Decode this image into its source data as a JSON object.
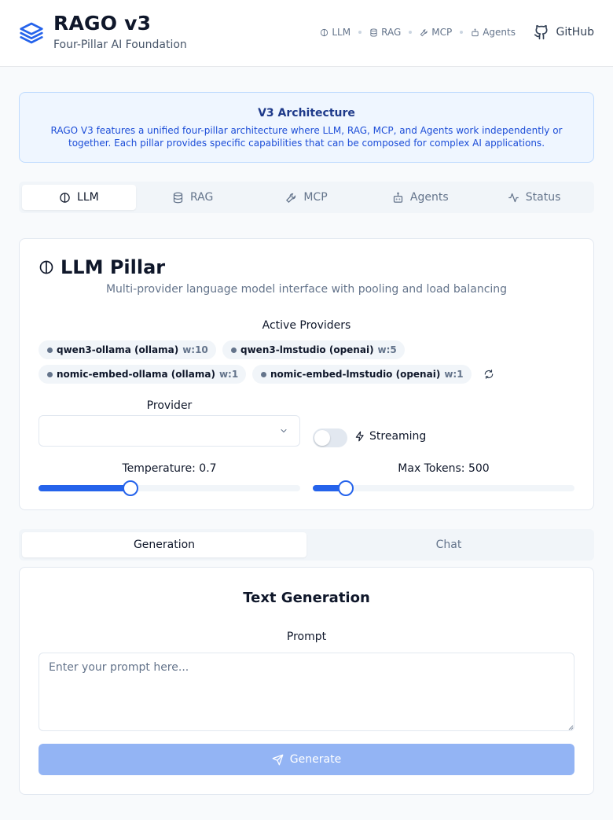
{
  "header": {
    "title": "RAGO v3",
    "subtitle": "Four-Pillar AI Foundation",
    "nav": [
      {
        "label": "LLM",
        "icon": "brain-icon"
      },
      {
        "label": "RAG",
        "icon": "database-icon"
      },
      {
        "label": "MCP",
        "icon": "wrench-icon"
      },
      {
        "label": "Agents",
        "icon": "bot-icon"
      }
    ],
    "github_label": "GitHub"
  },
  "banner": {
    "title": "V3 Architecture",
    "text": "RAGO V3 features a unified four-pillar architecture where LLM, RAG, MCP, and Agents work independently or together. Each pillar provides specific capabilities that can be composed for complex AI applications."
  },
  "pillar_tabs": [
    {
      "label": "LLM",
      "icon": "brain-icon",
      "active": true
    },
    {
      "label": "RAG",
      "icon": "database-icon",
      "active": false
    },
    {
      "label": "MCP",
      "icon": "wrench-icon",
      "active": false
    },
    {
      "label": "Agents",
      "icon": "bot-icon",
      "active": false
    },
    {
      "label": "Status",
      "icon": "activity-icon",
      "active": false
    }
  ],
  "llm_card": {
    "title": "LLM Pillar",
    "description": "Multi-provider language model interface with pooling and load balancing",
    "active_providers_label": "Active Providers",
    "providers": [
      {
        "name": "qwen3-ollama (ollama)",
        "weight": "w:10"
      },
      {
        "name": "qwen3-lmstudio (openai)",
        "weight": "w:5"
      },
      {
        "name": "nomic-embed-ollama (ollama)",
        "weight": "w:1"
      },
      {
        "name": "nomic-embed-lmstudio (openai)",
        "weight": "w:1"
      }
    ],
    "provider_label": "Provider",
    "provider_value": "",
    "streaming_label": "Streaming",
    "streaming_enabled": false,
    "temperature_label": "Temperature: 0.7",
    "temperature_value": 0.7,
    "temperature_max": 2,
    "max_tokens_label": "Max Tokens: 500",
    "max_tokens_value": 500,
    "max_tokens_max": 4000
  },
  "mode_tabs": [
    {
      "label": "Generation",
      "active": true
    },
    {
      "label": "Chat",
      "active": false
    }
  ],
  "generation": {
    "title": "Text Generation",
    "prompt_label": "Prompt",
    "prompt_placeholder": "Enter your prompt here...",
    "prompt_value": "",
    "generate_label": "Generate"
  },
  "colors": {
    "accent": "#2563eb",
    "banner_bg": "#eff6ff",
    "generate_disabled": "#93b4f4"
  }
}
